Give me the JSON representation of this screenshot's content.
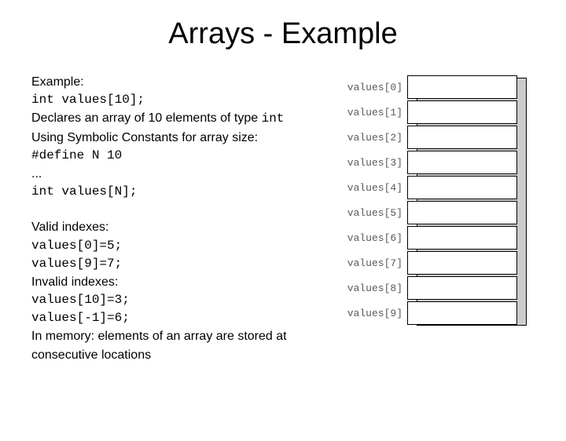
{
  "title": "Arrays - Example",
  "block1": {
    "l1": "Example:",
    "l2": "int values[10];",
    "l3a": "Declares an array of 10 elements of type ",
    "l3b": "int",
    "l4": "Using Symbolic Constants for array size:",
    "l5": "#define N  10",
    "l6": "...",
    "l7": "int values[N];"
  },
  "block2": {
    "l1": "Valid indexes:",
    "l2": "values[0]=5;",
    "l3": "values[9]=7;",
    "l4": "Invalid indexes:",
    "l5": "values[10]=3;",
    "l6": "values[-1]=6;",
    "l7": "In memory: elements of an array are stored at consecutive  locations"
  },
  "diagram": {
    "labels": [
      "values[0]",
      "values[1]",
      "values[2]",
      "values[3]",
      "values[4]",
      "values[5]",
      "values[6]",
      "values[7]",
      "values[8]",
      "values[9]"
    ]
  }
}
